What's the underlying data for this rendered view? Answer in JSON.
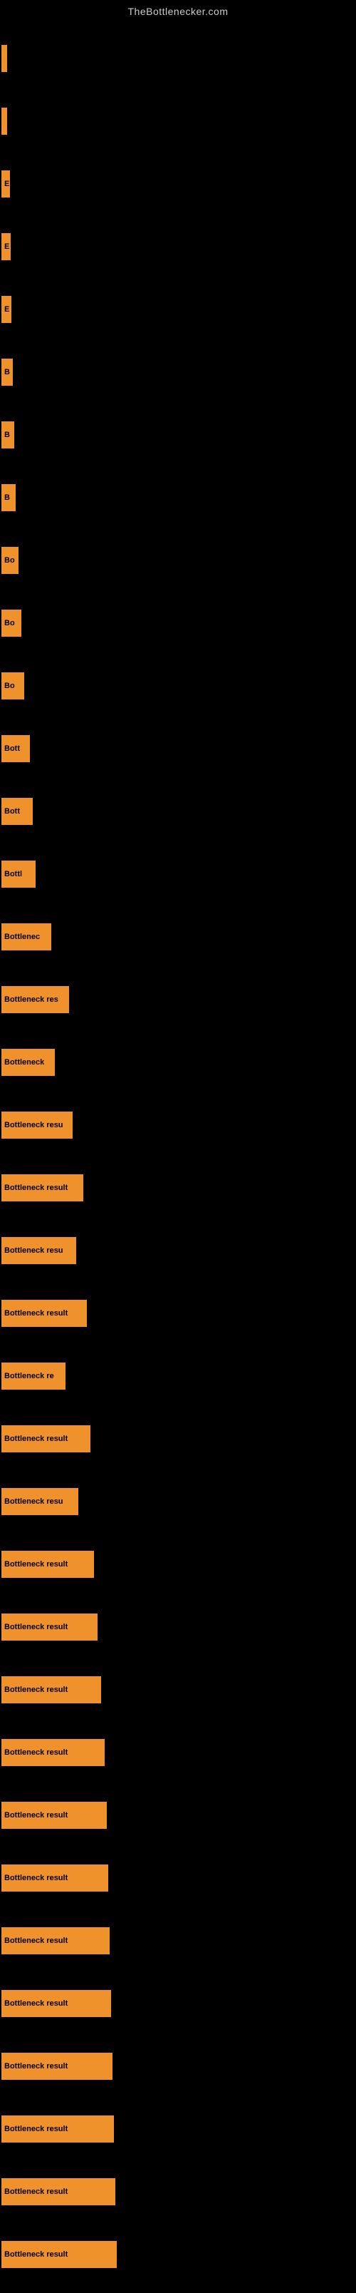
{
  "site": {
    "title": "TheBottlenecker.com"
  },
  "bars": [
    {
      "id": 1,
      "label": "",
      "width": 8,
      "text": ""
    },
    {
      "id": 2,
      "label": "",
      "width": 8,
      "text": ""
    },
    {
      "id": 3,
      "label": "E",
      "width": 12,
      "text": "E"
    },
    {
      "id": 4,
      "label": "E",
      "width": 13,
      "text": "E"
    },
    {
      "id": 5,
      "label": "E",
      "width": 14,
      "text": "E"
    },
    {
      "id": 6,
      "label": "B",
      "width": 16,
      "text": "B"
    },
    {
      "id": 7,
      "label": "B",
      "width": 18,
      "text": "B"
    },
    {
      "id": 8,
      "label": "B",
      "width": 20,
      "text": "B"
    },
    {
      "id": 9,
      "label": "Bo",
      "width": 24,
      "text": "Bo"
    },
    {
      "id": 10,
      "label": "Bo",
      "width": 28,
      "text": "Bo"
    },
    {
      "id": 11,
      "label": "Bo",
      "width": 32,
      "text": "Bo"
    },
    {
      "id": 12,
      "label": "Bott",
      "width": 40,
      "text": "Bott"
    },
    {
      "id": 13,
      "label": "Bott",
      "width": 44,
      "text": "Bott"
    },
    {
      "id": 14,
      "label": "Bottl",
      "width": 48,
      "text": "Bottl"
    },
    {
      "id": 15,
      "label": "Bottlenec",
      "width": 70,
      "text": "Bottlenec"
    },
    {
      "id": 16,
      "label": "Bottleneck res",
      "width": 95,
      "text": "Bottleneck res"
    },
    {
      "id": 17,
      "label": "Bottleneck",
      "width": 75,
      "text": "Bottleneck"
    },
    {
      "id": 18,
      "label": "Bottleneck resu",
      "width": 100,
      "text": "Bottleneck resu"
    },
    {
      "id": 19,
      "label": "Bottleneck result",
      "width": 115,
      "text": "Bottleneck result"
    },
    {
      "id": 20,
      "label": "Bottleneck resu",
      "width": 105,
      "text": "Bottleneck resu"
    },
    {
      "id": 21,
      "label": "Bottleneck result",
      "width": 120,
      "text": "Bottleneck result"
    },
    {
      "id": 22,
      "label": "Bottleneck re",
      "width": 90,
      "text": "Bottleneck re"
    },
    {
      "id": 23,
      "label": "Bottleneck result",
      "width": 125,
      "text": "Bottleneck result"
    },
    {
      "id": 24,
      "label": "Bottleneck resu",
      "width": 108,
      "text": "Bottleneck resu"
    },
    {
      "id": 25,
      "label": "Bottleneck result",
      "width": 130,
      "text": "Bottleneck result"
    },
    {
      "id": 26,
      "label": "Bottleneck result",
      "width": 135,
      "text": "Bottleneck result"
    },
    {
      "id": 27,
      "label": "Bottleneck result",
      "width": 140,
      "text": "Bottleneck result"
    },
    {
      "id": 28,
      "label": "Bottleneck result",
      "width": 145,
      "text": "Bottleneck result"
    },
    {
      "id": 29,
      "label": "Bottleneck result",
      "width": 148,
      "text": "Bottleneck result"
    },
    {
      "id": 30,
      "label": "Bottleneck result",
      "width": 150,
      "text": "Bottleneck result"
    },
    {
      "id": 31,
      "label": "Bottleneck result",
      "width": 152,
      "text": "Bottleneck result"
    },
    {
      "id": 32,
      "label": "Bottleneck result",
      "width": 154,
      "text": "Bottleneck result"
    },
    {
      "id": 33,
      "label": "Bottleneck result",
      "width": 156,
      "text": "Bottleneck result"
    },
    {
      "id": 34,
      "label": "Bottleneck result",
      "width": 158,
      "text": "Bottleneck result"
    },
    {
      "id": 35,
      "label": "Bottleneck result",
      "width": 160,
      "text": "Bottleneck result"
    },
    {
      "id": 36,
      "label": "Bottleneck result",
      "width": 162,
      "text": "Bottleneck result"
    }
  ]
}
